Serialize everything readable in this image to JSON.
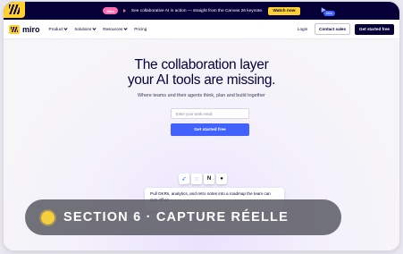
{
  "announcement": {
    "pill_label": "Miro",
    "message": "See collaborative AI in action — straight from the Canvas 26 keynote.",
    "watch_label": "Watch now"
  },
  "cursor": {
    "label": "Miro"
  },
  "nav": {
    "logo_text": "miro",
    "items": [
      {
        "label": "Product"
      },
      {
        "label": "Solutions"
      },
      {
        "label": "Resources"
      },
      {
        "label": "Pricing"
      }
    ],
    "login_label": "Login",
    "contact_label": "Contact sales",
    "get_started_label": "Get started free"
  },
  "hero": {
    "title_line1": "The collaboration layer",
    "title_line2": "your AI tools are missing.",
    "subtitle": "Where teams and their agents think, plan and build together",
    "email_placeholder": "Enter your work email",
    "cta_label": "Get started free"
  },
  "integrations": [
    "jira-icon",
    "confluence-icon",
    "notion-icon",
    "github-icon"
  ],
  "canvas_card": {
    "text": "Pull OKRs, analytics, and retro notes into a roadmap the team can sign off on."
  },
  "overlay_badge": {
    "label": "SECTION 6 · CAPTURE RÉELLE",
    "dot_color": "#f6cf3c"
  },
  "colors": {
    "brand_yellow": "#ffd02f",
    "navy": "#050038",
    "cta_blue": "#4262ff"
  }
}
